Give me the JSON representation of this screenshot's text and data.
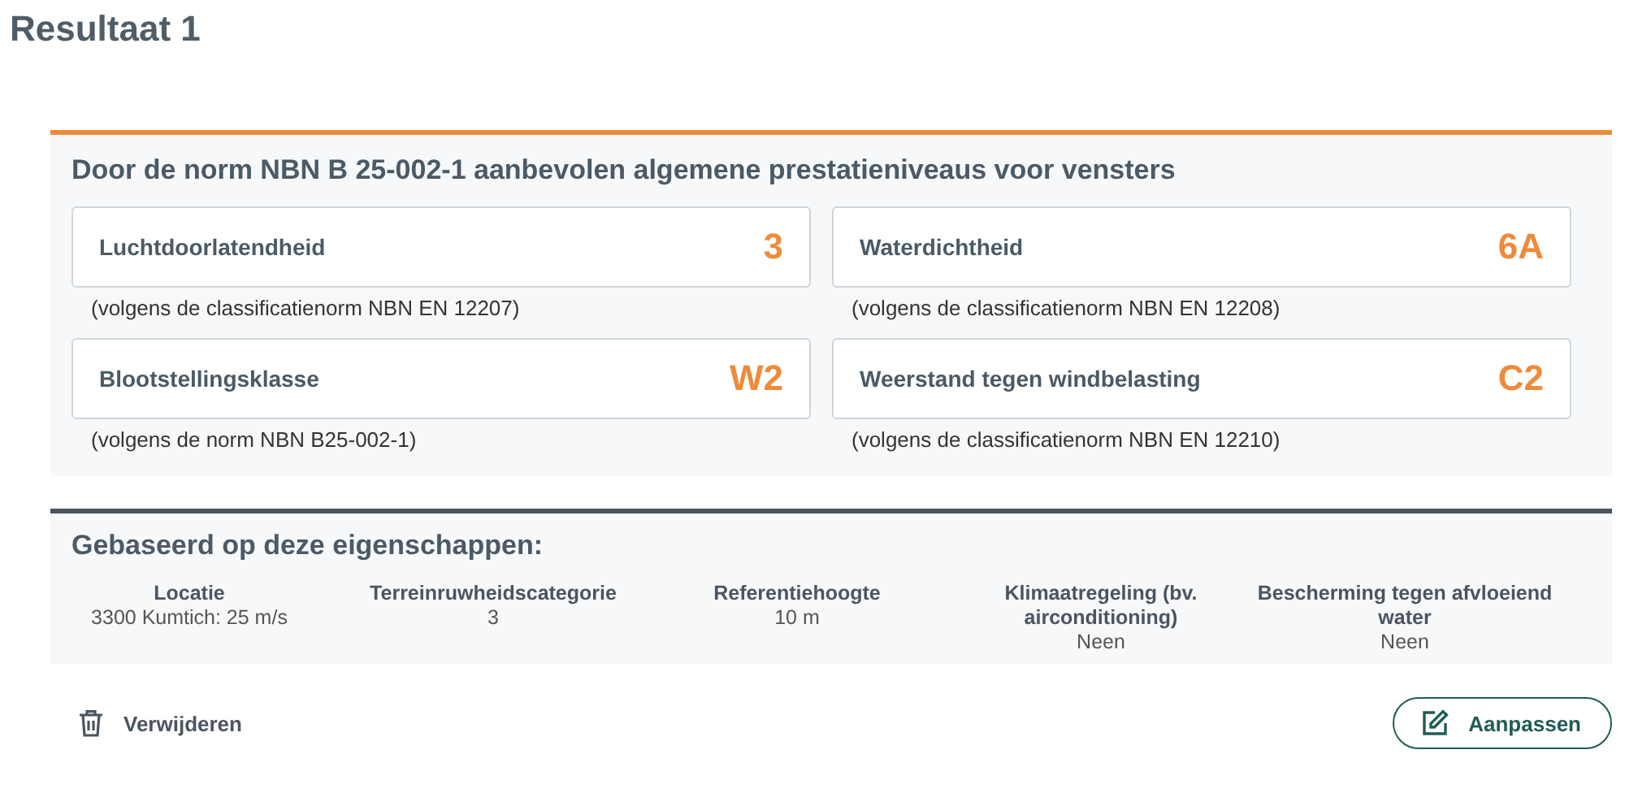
{
  "title": "Resultaat 1",
  "levels": {
    "heading": "Door de norm NBN B 25-002-1 aanbevolen algemene prestatieniveaus voor vensters",
    "cards": [
      {
        "label": "Luchtdoorlatendheid",
        "value": "3",
        "note": "(volgens de classificatienorm NBN EN 12207)"
      },
      {
        "label": "Waterdichtheid",
        "value": "6A",
        "note": "(volgens de classificatienorm NBN EN 12208)"
      },
      {
        "label": "Blootstellingsklasse",
        "value": "W2",
        "note": "(volgens de norm NBN B25-002-1)"
      },
      {
        "label": "Weerstand tegen windbelasting",
        "value": "C2",
        "note": "(volgens de classificatienorm NBN EN 12210)"
      }
    ]
  },
  "properties": {
    "heading": "Gebaseerd op deze eigenschappen:",
    "items": [
      {
        "label": "Locatie",
        "value": "3300 Kumtich: 25 m/s"
      },
      {
        "label": "Terreinruwheidscategorie",
        "value": "3"
      },
      {
        "label": "Referentiehoogte",
        "value": "10 m"
      },
      {
        "label": "Klimaatregeling (bv. airconditioning)",
        "value": "Neen"
      },
      {
        "label": "Bescherming tegen afvloeiend water",
        "value": "Neen"
      }
    ]
  },
  "actions": {
    "delete": "Verwijderen",
    "edit": "Aanpassen"
  }
}
